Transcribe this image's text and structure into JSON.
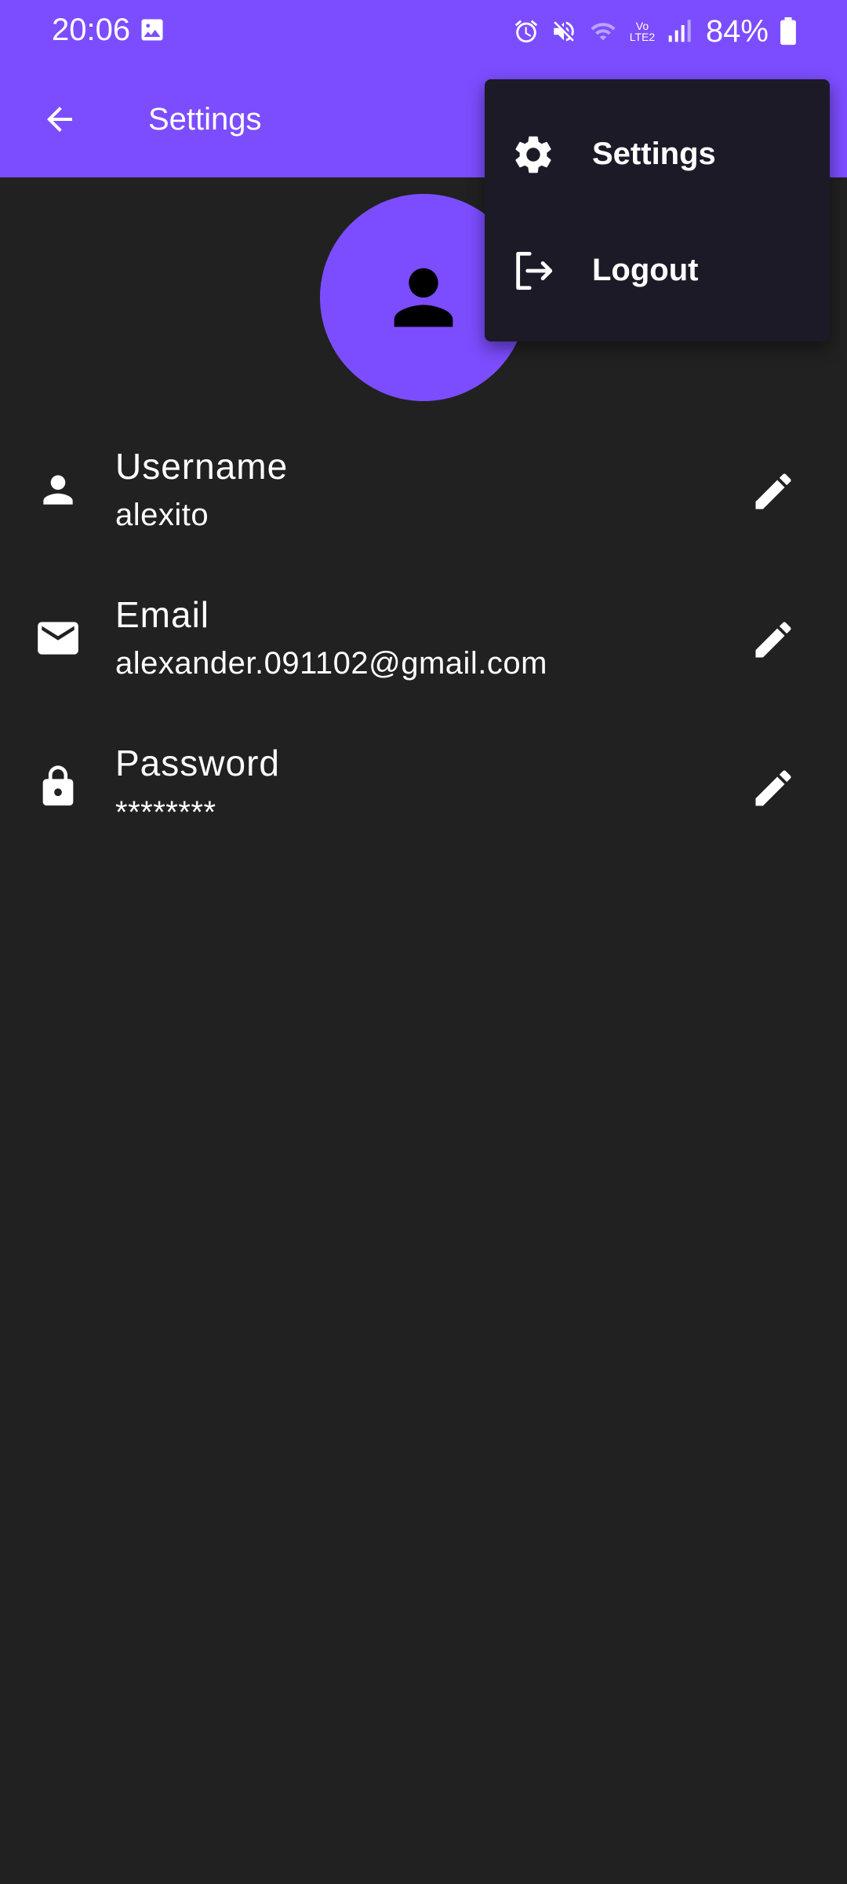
{
  "status_bar": {
    "time": "20:06",
    "battery": "84%",
    "network_label": "Vo LTE2",
    "icons": [
      "gallery-icon",
      "alarm-icon",
      "mute-icon",
      "wifi-icon",
      "signal-icon",
      "battery-icon"
    ]
  },
  "app_bar": {
    "title": "Settings",
    "back_icon": "arrow-back-icon"
  },
  "profile": {
    "avatar_icon": "person-icon"
  },
  "fields": [
    {
      "label": "Username",
      "value": "alexito",
      "icon": "person-icon"
    },
    {
      "label": "Email",
      "value": "alexander.091102@gmail.com",
      "icon": "email-icon"
    },
    {
      "label": "Password",
      "value": "********",
      "icon": "lock-icon"
    }
  ],
  "menu": {
    "items": [
      {
        "label": "Settings",
        "icon": "gear-icon"
      },
      {
        "label": "Logout",
        "icon": "logout-icon"
      }
    ]
  },
  "colors": {
    "accent": "#7c4dff",
    "background": "#212121",
    "menu_background": "#1c1a26",
    "text": "#ffffff"
  }
}
